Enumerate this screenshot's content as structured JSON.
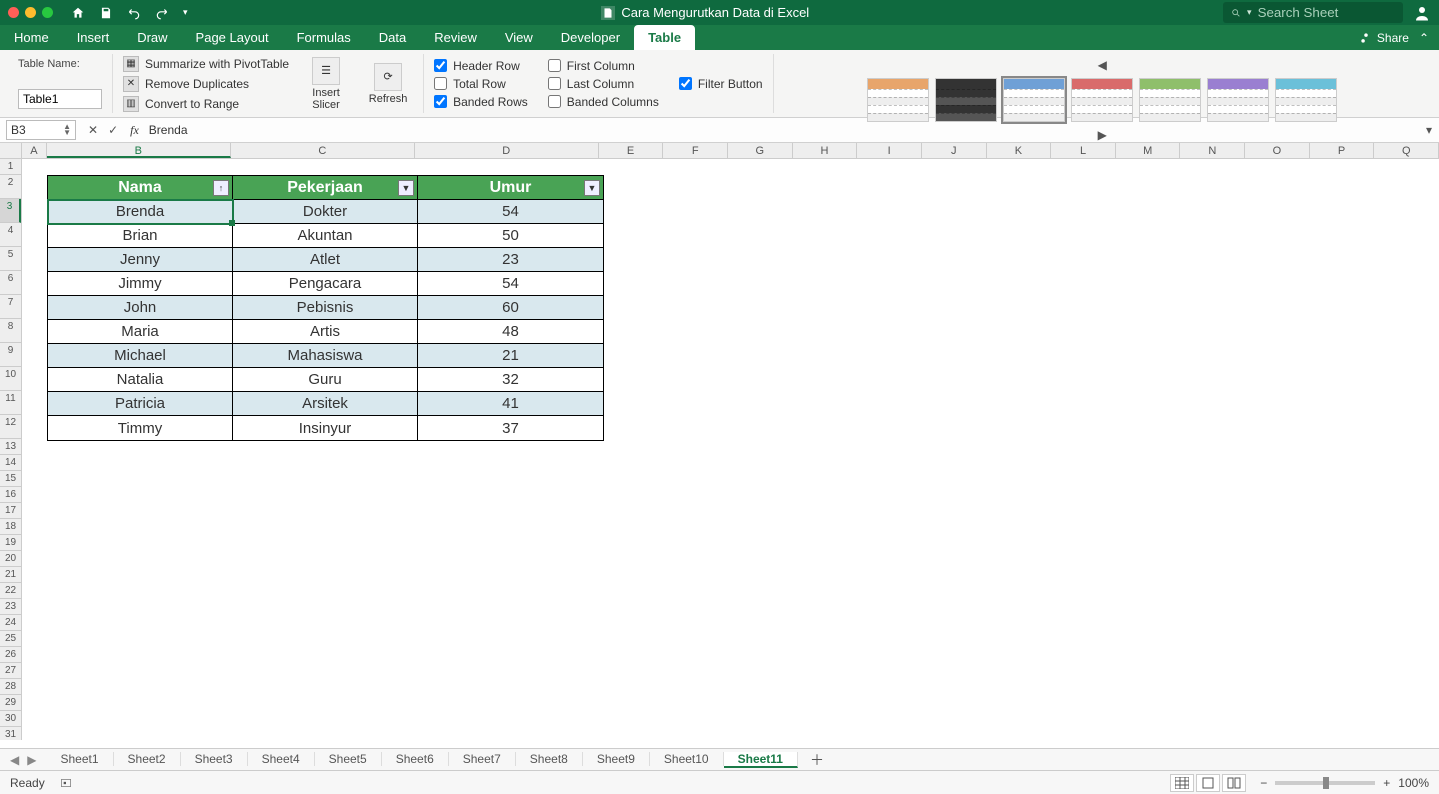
{
  "window": {
    "title": "Cara Mengurutkan Data di Excel"
  },
  "search": {
    "placeholder": "Search Sheet"
  },
  "share": {
    "label": "Share"
  },
  "menu": {
    "tabs": [
      "Home",
      "Insert",
      "Draw",
      "Page Layout",
      "Formulas",
      "Data",
      "Review",
      "View",
      "Developer",
      "Table"
    ],
    "active": "Table"
  },
  "ribbon": {
    "tableNameLabel": "Table Name:",
    "tableNameValue": "Table1",
    "tools": {
      "pivot": "Summarize with PivotTable",
      "dup": "Remove Duplicates",
      "range": "Convert to Range",
      "slicer": "Insert Slicer",
      "refresh": "Refresh"
    },
    "options": {
      "headerRow": {
        "label": "Header Row",
        "checked": true
      },
      "totalRow": {
        "label": "Total Row",
        "checked": false
      },
      "bandedRows": {
        "label": "Banded Rows",
        "checked": true
      },
      "firstCol": {
        "label": "First Column",
        "checked": false
      },
      "lastCol": {
        "label": "Last Column",
        "checked": false
      },
      "bandedCols": {
        "label": "Banded Columns",
        "checked": false
      },
      "filterBtn": {
        "label": "Filter Button",
        "checked": true
      }
    },
    "styleColors": [
      "#e8a56b",
      "#333",
      "#6fa0d6",
      "#d96b6b",
      "#8fbf6b",
      "#9a7fd1",
      "#6bc0d9"
    ]
  },
  "formula": {
    "cellRef": "B3",
    "value": "Brenda"
  },
  "grid": {
    "columns": [
      "A",
      "B",
      "C",
      "D",
      "E",
      "F",
      "G",
      "H",
      "I",
      "J",
      "K",
      "L",
      "M",
      "N",
      "O",
      "P",
      "Q"
    ],
    "rows": 32,
    "selected": {
      "row": 3,
      "col": "B"
    }
  },
  "table": {
    "headers": [
      "Nama",
      "Pekerjaan",
      "Umur"
    ],
    "sortCol": 0,
    "rows": [
      {
        "name": "Brenda",
        "job": "Dokter",
        "age": "54"
      },
      {
        "name": "Brian",
        "job": "Akuntan",
        "age": "50"
      },
      {
        "name": "Jenny",
        "job": "Atlet",
        "age": "23"
      },
      {
        "name": "Jimmy",
        "job": "Pengacara",
        "age": "54"
      },
      {
        "name": "John",
        "job": "Pebisnis",
        "age": "60"
      },
      {
        "name": "Maria",
        "job": "Artis",
        "age": "48"
      },
      {
        "name": "Michael",
        "job": "Mahasiswa",
        "age": "21"
      },
      {
        "name": "Natalia",
        "job": "Guru",
        "age": "32"
      },
      {
        "name": "Patricia",
        "job": "Arsitek",
        "age": "41"
      },
      {
        "name": "Timmy",
        "job": "Insinyur",
        "age": "37"
      }
    ]
  },
  "sheets": {
    "tabs": [
      "Sheet1",
      "Sheet2",
      "Sheet3",
      "Sheet4",
      "Sheet5",
      "Sheet6",
      "Sheet7",
      "Sheet8",
      "Sheet9",
      "Sheet10",
      "Sheet11"
    ],
    "active": "Sheet11"
  },
  "status": {
    "ready": "Ready",
    "zoom": "100%"
  }
}
